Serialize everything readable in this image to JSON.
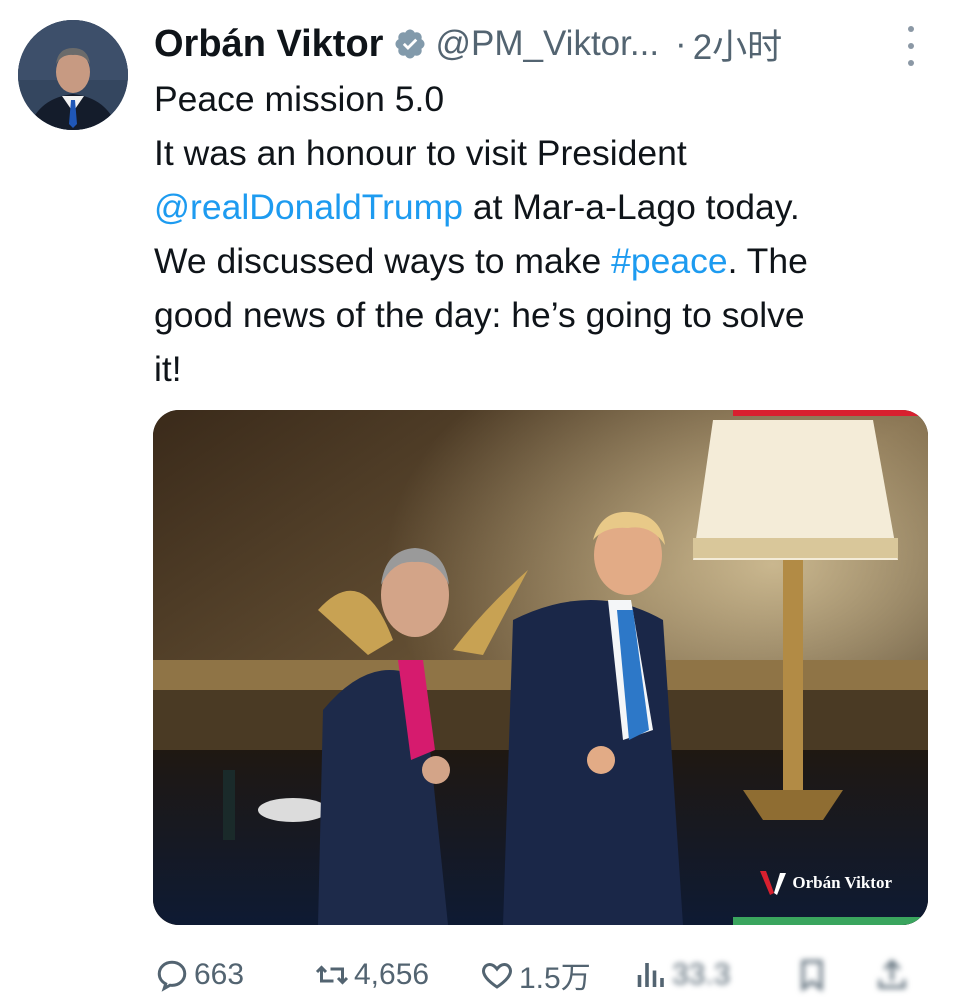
{
  "tweet": {
    "author_name": "Orbán Viktor",
    "handle": "@PM_Viktor...",
    "separator": "·",
    "time": "2小时",
    "text_lines": [
      "Peace mission 5.0",
      "It was an honour to visit President"
    ],
    "mention": "@realDonaldTrump",
    "after_mention": " at Mar-a-Lago today.",
    "line4_before": "We discussed ways to make ",
    "hashtag": "#peace",
    "line4_after": ". The",
    "line5": "good news of the day: he’s going to solve",
    "line6": "it!"
  },
  "media": {
    "watermark_text": "Orbán Viktor",
    "accent_red": "#d8202f",
    "accent_green": "#3aa55e"
  },
  "actions": {
    "replies": "663",
    "retweets": "4,656",
    "likes": "1.5万",
    "views": "33.3"
  },
  "colors": {
    "link": "#1d9bf0",
    "muted": "#536471",
    "verified": "#829aab"
  },
  "icons": [
    "verified-badge-icon",
    "more-options-icon",
    "reply-icon",
    "retweet-icon",
    "like-icon",
    "views-icon",
    "bookmark-icon",
    "share-icon"
  ]
}
